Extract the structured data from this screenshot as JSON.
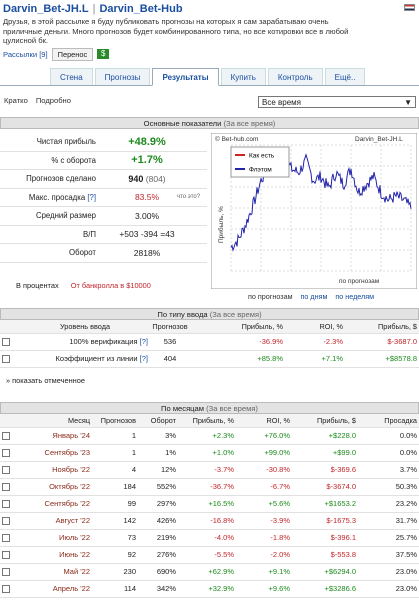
{
  "header": {
    "author": "Darvin_Bet-JH.L",
    "sep": "|",
    "service": "Darvin_Bet-Hub",
    "description": "Друзья, в этой рассылке я буду публиковать прогнозы на которых я сам зарабатываю очень приличные деньги. Много прогнозов будет комбинированного типа, но все котировки все в любой цулисной бк.",
    "subs_label": "Рассылки [9]",
    "move_btn": "Перенос",
    "download_icon": "$"
  },
  "tabs": [
    "Стена",
    "Прогнозы",
    "Результаты",
    "Купить",
    "Контроль",
    "Ещё.."
  ],
  "view": {
    "short": "Кратко",
    "detailed": "Подробно",
    "period": "Все время"
  },
  "main": {
    "title": "Основные показатели",
    "sub": "(За все время)",
    "rows": [
      {
        "label": "Чистая прибыль",
        "value": "+48.9%"
      },
      {
        "label": "% с оборота",
        "value": "+1.7%"
      },
      {
        "label": "Прогнозов сделано",
        "value": "940",
        "extra": "(804)"
      },
      {
        "label": "Макс. просадка",
        "q": "[?]",
        "value": "83.5%",
        "note": "что это?"
      },
      {
        "label": "Средний размер",
        "value": "3.00%"
      },
      {
        "label": "В/П",
        "value": "+503 -394 =43"
      },
      {
        "label": "Оборот",
        "value": "2818%"
      }
    ],
    "in_pct": "В процентах",
    "from_bank": "От банкролла в $10000"
  },
  "chart_data": {
    "type": "line",
    "site": "© Bet-hub.com",
    "author": "Darvin_Bet-JH.L",
    "ylabel": "Прибыль, %",
    "xlabel": "по прогнозам",
    "series": [
      {
        "name": "Как есть",
        "color": "#cc2222",
        "values": []
      },
      {
        "name": "Флэтом",
        "color": "#2222aa",
        "values": [
          0,
          10,
          30,
          55,
          85,
          100,
          110,
          120,
          100,
          95,
          110,
          85,
          90,
          75,
          95,
          80,
          100,
          70,
          80,
          90,
          70,
          60,
          65,
          60,
          50
        ]
      }
    ],
    "x_modes": [
      "по прогнозам",
      "по дням",
      "по неделям"
    ]
  },
  "bytype": {
    "title": "По типу ввода",
    "sub": "(За все время)",
    "headers": [
      "",
      "Уровень ввода",
      "Прогнозов",
      "",
      "Прибыль, %",
      "ROI, %",
      "Прибыль, $"
    ],
    "rows": [
      [
        "100% верификация",
        "[?]",
        "536",
        "-36.9%",
        "-2.3%",
        "$-3687.0"
      ],
      [
        "Коэффициент из линии",
        "[?]",
        "404",
        "+85.8%",
        "+7.1%",
        "+$8578.8"
      ]
    ],
    "show_marked": "» показать отмеченное"
  },
  "bymonth": {
    "title": "По месяцам",
    "sub": "(За все время)",
    "headers": [
      "",
      "Месяц",
      "Прогнозов",
      "Оборот",
      "Прибыль, %",
      "ROI, %",
      "Прибыль, $",
      "Просадка"
    ],
    "rows": [
      [
        "Январь '24",
        "1",
        "3%",
        "+2.3%",
        "+76.0%",
        "+$228.0",
        "0.0%"
      ],
      [
        "Сентябрь '23",
        "1",
        "1%",
        "+1.0%",
        "+99.0%",
        "+$99.0",
        "0.0%"
      ],
      [
        "Ноябрь '22",
        "4",
        "12%",
        "-3.7%",
        "-30.8%",
        "$-369.6",
        "3.7%"
      ],
      [
        "Октябрь '22",
        "184",
        "552%",
        "-36.7%",
        "-6.7%",
        "$-3674.0",
        "50.3%"
      ],
      [
        "Сентябрь '22",
        "99",
        "297%",
        "+16.5%",
        "+5.6%",
        "+$1653.2",
        "23.2%"
      ],
      [
        "Август '22",
        "142",
        "426%",
        "-16.8%",
        "-3.9%",
        "$-1675.3",
        "31.7%"
      ],
      [
        "Июль '22",
        "73",
        "219%",
        "-4.0%",
        "-1.8%",
        "$-396.1",
        "25.7%"
      ],
      [
        "Июнь '22",
        "92",
        "276%",
        "-5.5%",
        "-2.0%",
        "$-553.8",
        "37.5%"
      ],
      [
        "Май '22",
        "230",
        "690%",
        "+62.9%",
        "+9.1%",
        "+$6294.0",
        "23.0%"
      ],
      [
        "Апрель '22",
        "114",
        "342%",
        "+32.9%",
        "+9.6%",
        "+$3286.6",
        "23.0%"
      ]
    ]
  }
}
